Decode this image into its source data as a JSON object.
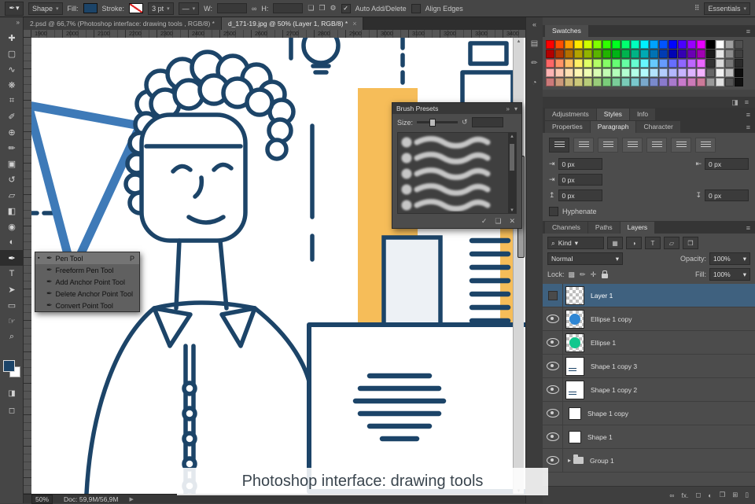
{
  "caption": {
    "text": "Photoshop interface: drawing tools"
  },
  "icons": {
    "chevron_down": "▾",
    "menu": "≡",
    "close": "×",
    "dbl_left": "«",
    "dbl_right": "»",
    "pen": "✒",
    "bullet": "▪",
    "check": "✓",
    "gear": "⚙",
    "link": "∞",
    "search": "⌕",
    "reset": "↺",
    "grid": "⠿",
    "play": "▶",
    "up": "▴",
    "down": "▾",
    "line": "—",
    "combine": "❏",
    "combine2": "❐",
    "indent_left": "⇥",
    "indent_right": "⇤",
    "indent_first": "⇥",
    "space_before": "↥",
    "space_after": "↧",
    "filter_pixel": "▦",
    "filter_adjust": "◑",
    "filter_type": "T",
    "filter_shape": "▱",
    "filter_smart": "❒",
    "lock_transparent": "▩",
    "lock_paint": "✏",
    "lock_move": "✛",
    "fx": "fx.",
    "mask": "◻",
    "adjustment": "◐",
    "group_folder": "❒",
    "new_item": "⊞",
    "delete_item": "▯",
    "delete_x": "✕",
    "panel_a": "▤",
    "panel_b": "✏",
    "panel_c": "◔",
    "half_square": "◨",
    "triangle_right": "▸"
  },
  "options_bar": {
    "tool_preset": "Shape",
    "fill_label": "Fill:",
    "stroke_label": "Stroke:",
    "stroke_width": "3 pt",
    "w_label": "W:",
    "w_value": "",
    "h_label": "H:",
    "h_value": "",
    "auto_add_delete": "Auto Add/Delete",
    "align_edges": "Align Edges",
    "workspace": "Essentials"
  },
  "document_tabs": [
    {
      "label": "2.psd @ 66,7% (Photoshop interface: drawing tools , RGB/8) *"
    },
    {
      "label": "d_171-19.jpg @ 50% (Layer 1, RGB/8) *"
    }
  ],
  "ruler_numbers": [
    "1900",
    "2000",
    "2100",
    "2200",
    "2300",
    "2400",
    "2500",
    "2600",
    "2700",
    "2800",
    "2900",
    "3000",
    "3100",
    "3200",
    "3300",
    "3400"
  ],
  "toolbar": {
    "tools": [
      {
        "name": "move-tool",
        "glyph": "✚"
      },
      {
        "name": "marquee-tool",
        "glyph": "▢"
      },
      {
        "name": "lasso-tool",
        "glyph": "∿"
      },
      {
        "name": "quick-selection-tool",
        "glyph": "❋"
      },
      {
        "name": "crop-tool",
        "glyph": "⌗"
      },
      {
        "name": "eyedropper-tool",
        "glyph": "✐"
      },
      {
        "name": "healing-brush-tool",
        "glyph": "⊕"
      },
      {
        "name": "brush-tool",
        "glyph": "✏"
      },
      {
        "name": "clone-stamp-tool",
        "glyph": "▣"
      },
      {
        "name": "history-brush-tool",
        "glyph": "↺"
      },
      {
        "name": "eraser-tool",
        "glyph": "▱"
      },
      {
        "name": "gradient-tool",
        "glyph": "◧"
      },
      {
        "name": "blur-tool",
        "glyph": "◉"
      },
      {
        "name": "dodge-tool",
        "glyph": "◐"
      },
      {
        "name": "pen-tool",
        "glyph": "✒",
        "active": true
      },
      {
        "name": "type-tool",
        "glyph": "T"
      },
      {
        "name": "path-selection-tool",
        "glyph": "➤"
      },
      {
        "name": "rectangle-tool",
        "glyph": "▭"
      },
      {
        "name": "hand-tool",
        "glyph": "☞"
      },
      {
        "name": "zoom-tool",
        "glyph": "⌕"
      }
    ]
  },
  "pen_menu": {
    "items": [
      {
        "label": "Pen Tool",
        "shortcut": "P",
        "selected": true
      },
      {
        "label": "Freeform Pen Tool",
        "shortcut": ""
      },
      {
        "label": "Add Anchor Point Tool",
        "shortcut": ""
      },
      {
        "label": "Delete Anchor Point Tool",
        "shortcut": ""
      },
      {
        "label": "Convert Point Tool",
        "shortcut": ""
      }
    ]
  },
  "brush_panel": {
    "title": "Brush Presets",
    "size_label": "Size:"
  },
  "swatches_panel": {
    "title": "Swatches",
    "colors": [
      "#ff0000",
      "#ff4f00",
      "#ff9e00",
      "#ffe900",
      "#cfff00",
      "#80ff00",
      "#30ff00",
      "#00ff20",
      "#00ff6f",
      "#00ffbe",
      "#00f2ff",
      "#00a3ff",
      "#0054ff",
      "#0005ff",
      "#4a00ff",
      "#9900ff",
      "#e800ff",
      "#000000",
      "#ffffff",
      "#a0a0a0",
      "#505050",
      "#b30000",
      "#b33700",
      "#b36f00",
      "#b3a300",
      "#91b300",
      "#5ab300",
      "#22b300",
      "#00b316",
      "#00b34e",
      "#00b385",
      "#00aab3",
      "#0072b3",
      "#003bb3",
      "#0003b3",
      "#3400b3",
      "#6b00b3",
      "#a200b3",
      "#1a1a1a",
      "#e6e6e6",
      "#8c8c8c",
      "#404040",
      "#ff6666",
      "#ff9466",
      "#ffc266",
      "#fff066",
      "#e1ff66",
      "#b3ff66",
      "#85ff66",
      "#66ff74",
      "#66ffa3",
      "#66ffd1",
      "#66f7ff",
      "#66c9ff",
      "#669bff",
      "#666dff",
      "#8f66ff",
      "#bd66ff",
      "#eb66ff",
      "#333333",
      "#d9d9d9",
      "#777777",
      "#2b2b2b",
      "#ffb3b3",
      "#ffc9b3",
      "#ffe0b3",
      "#fff7b3",
      "#f0ffb3",
      "#d9ffb3",
      "#c2ffb3",
      "#b3ffba",
      "#b3ffd1",
      "#b3ffe8",
      "#b3fbff",
      "#b3e4ff",
      "#b3cdff",
      "#b3b6ff",
      "#c7b3ff",
      "#deb3ff",
      "#f5b3ff",
      "#666666",
      "#f2f2f2",
      "#bfbfbf",
      "#0d0d0d",
      "#cc7a7a",
      "#cc997a",
      "#ccb87a",
      "#ccc87a",
      "#b8cc7a",
      "#99cc7a",
      "#7acc7a",
      "#7acc99",
      "#7accb8",
      "#7ac8cc",
      "#7aa9cc",
      "#7a8acc",
      "#8a7acc",
      "#a97acc",
      "#c87acc",
      "#cc7ab8",
      "#cc7a99",
      "#999999",
      "#e0e0e0",
      "#555555",
      "#111111"
    ]
  },
  "panels": {
    "tabs_row1": [
      "Adjustments",
      "Styles",
      "Info"
    ],
    "tabs_row2": [
      "Properties",
      "Paragraph",
      "Character"
    ],
    "tabs_row3": [
      "Channels",
      "Paths",
      "Layers"
    ],
    "paragraph": {
      "indent_left": "0 px",
      "indent_right": "0 px",
      "indent_first": "0 px",
      "space_before": "0 px",
      "space_after": "0 px",
      "hyphenate": "Hyphenate"
    },
    "layers": {
      "filter_label": "Kind",
      "blend_mode": "Normal",
      "opacity_label": "Opacity:",
      "opacity_value": "100%",
      "lock_label": "Lock:",
      "fill_label": "Fill:",
      "fill_value": "100%",
      "rows": [
        {
          "name": "Layer 1",
          "thumb": "checker",
          "selected": true
        },
        {
          "name": "Ellipse 1 copy",
          "thumb": "ellipse",
          "thumb_color": "#2e86d4"
        },
        {
          "name": "Ellipse 1",
          "thumb": "ellipse",
          "thumb_color": "#12c78e"
        },
        {
          "name": "Shape 1 copy 3",
          "thumb": "white"
        },
        {
          "name": "Shape 1 copy 2",
          "thumb": "white"
        },
        {
          "name": "Shape 1 copy",
          "thumb": "small"
        },
        {
          "name": "Shape 1",
          "thumb": "small"
        },
        {
          "name": "Group 1",
          "thumb": "group"
        }
      ]
    }
  },
  "status_bar": {
    "zoom": "50%",
    "doc_info": "Doc: 59,9M/56,9M"
  },
  "artwork": {
    "line_color": "#1c4468",
    "accent_orange": "#f6bd59",
    "accent_blue": "#3e7ab8"
  }
}
